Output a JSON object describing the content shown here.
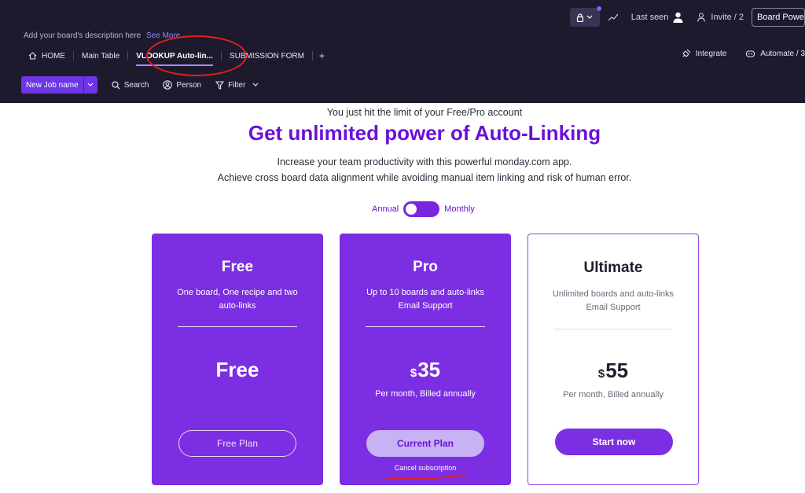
{
  "header": {
    "last_seen": "Last seen",
    "invite": "Invite / 2",
    "board_button": "Board Power-U",
    "description": "Add your board's description here",
    "see_more": "See More",
    "tabs": [
      {
        "label": "HOME"
      },
      {
        "label": "Main Table"
      },
      {
        "label": "VLOOKUP Auto-lin..."
      },
      {
        "label": "SUBMISSION FORM"
      }
    ],
    "add_tab": "+",
    "integrate": "Integrate",
    "automate": "Automate / 3"
  },
  "toolbar": {
    "new_item": "New Job name",
    "search": "Search",
    "person": "Person",
    "filter": "Filter"
  },
  "upsell": {
    "limit_notice": "You just hit the limit of your Free/Pro account",
    "headline": "Get unlimited power of Auto-Linking",
    "subline_1": "Increase your team productivity with this powerful monday.com app.",
    "subline_2": "Achieve cross board data alignment while avoiding manual item linking and risk of human error.",
    "toggle_annual": "Annual",
    "toggle_monthly": "Monthly"
  },
  "plans": {
    "free": {
      "title": "Free",
      "desc_1": "One board, One recipe and two",
      "desc_2": "auto-links",
      "price": "Free",
      "button": "Free Plan"
    },
    "pro": {
      "title": "Pro",
      "desc_1": "Up to 10 boards and auto-links",
      "desc_2": "Email Support",
      "currency": "$",
      "price": "35",
      "billing": "Per month, Billed annually",
      "button": "Current Plan",
      "cancel": "Cancel subscription"
    },
    "ultimate": {
      "title": "Ultimate",
      "desc_1": "Unlimited boards and auto-links",
      "desc_2": "Email Support",
      "currency": "$",
      "price": "55",
      "billing": "Per month, Billed annually",
      "button": "Start now"
    }
  },
  "colors": {
    "header_bg": "#1e1a2e",
    "brand_purple": "#7c2ee3",
    "headline_purple": "#6b10d9",
    "annotation_red": "#e0201e"
  }
}
